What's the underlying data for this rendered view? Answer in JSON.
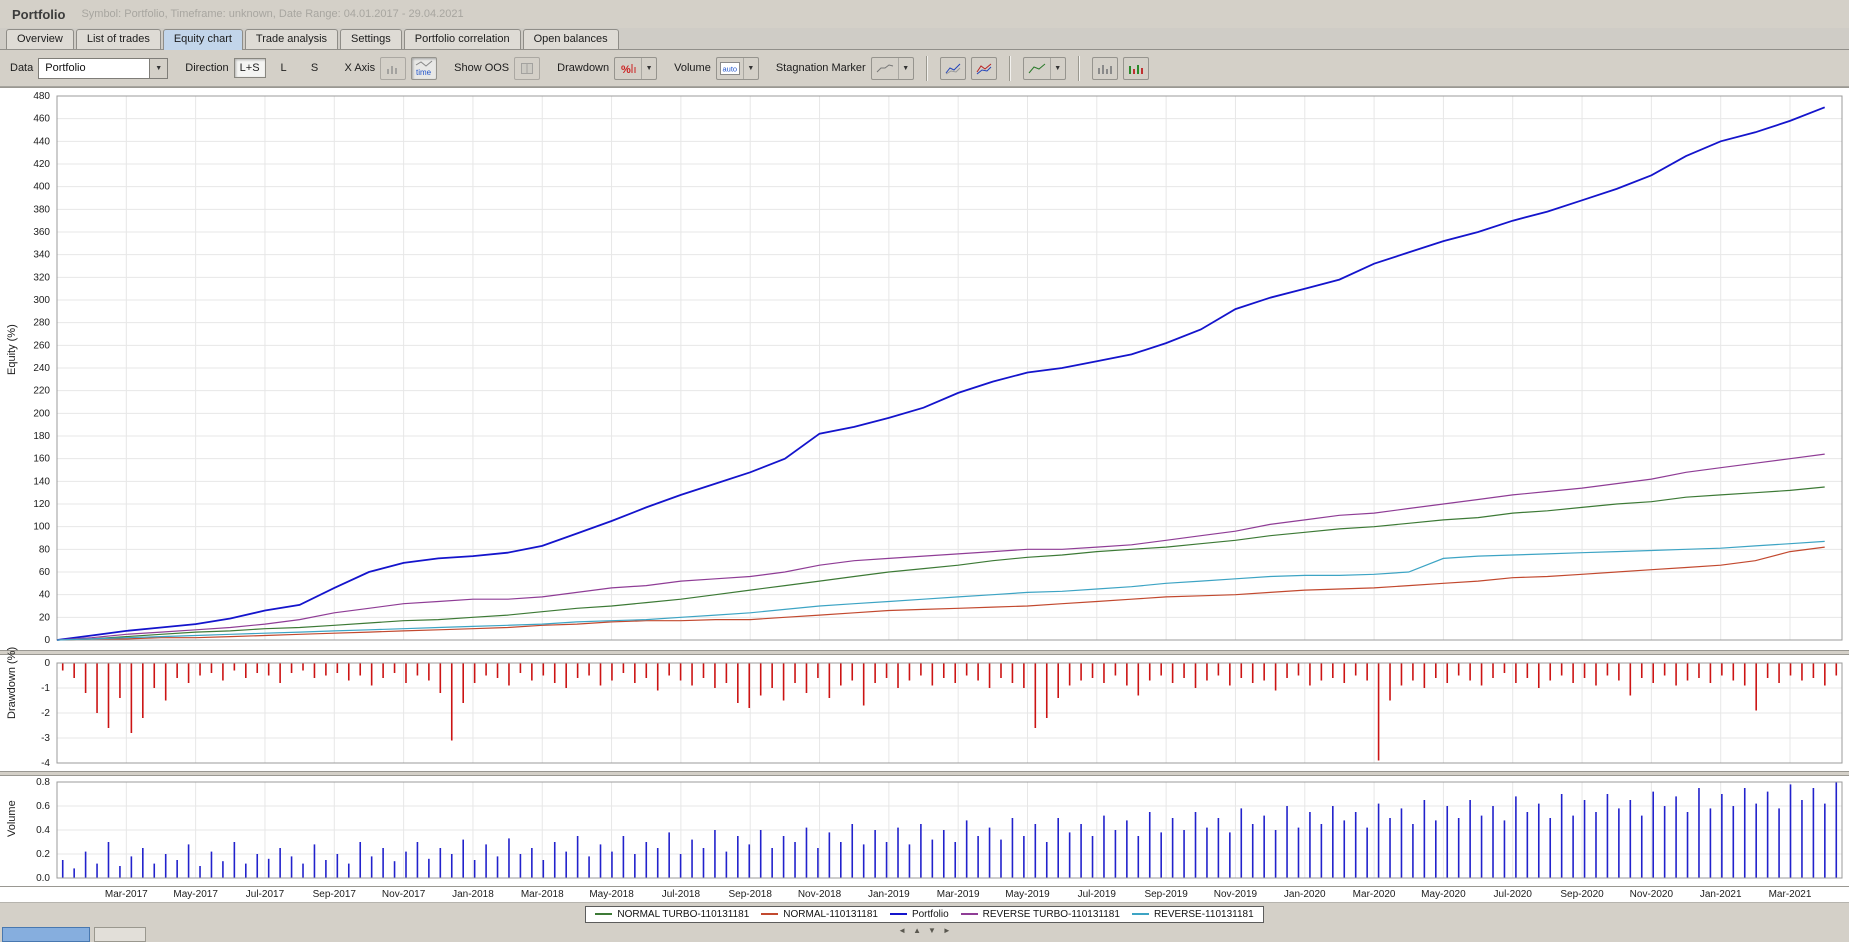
{
  "window": {
    "title": "Portfolio",
    "subtitle": "Symbol: Portfolio, Timeframe: unknown, Date Range: 04.01.2017 - 29.04.2021"
  },
  "tabs": [
    {
      "label": "Overview",
      "active": false
    },
    {
      "label": "List of trades",
      "active": false
    },
    {
      "label": "Equity chart",
      "active": true
    },
    {
      "label": "Trade analysis",
      "active": false
    },
    {
      "label": "Settings",
      "active": false
    },
    {
      "label": "Portfolio correlation",
      "active": false
    },
    {
      "label": "Open balances",
      "active": false
    }
  ],
  "toolbar": {
    "data_label": "Data",
    "data_value": "Portfolio",
    "direction_label": "Direction",
    "direction_options": [
      "L+S",
      "L",
      "S"
    ],
    "x_axis_label": "X Axis",
    "time_button_label": "time",
    "show_oos_label": "Show OOS",
    "drawdown_label": "Drawdown",
    "drawdown_icon_glyph": "%",
    "volume_label": "Volume",
    "volume_mode": "auto",
    "stagnation_label": "Stagnation Marker"
  },
  "chart_data": [
    {
      "type": "line",
      "ylabel": "Equity (%)",
      "ylim": [
        0,
        480
      ],
      "ytick_step": 20,
      "x_unit": "month",
      "x_start_label": "Jan-2017",
      "n_points": 52,
      "x_tick_months": [
        2,
        4,
        6,
        8,
        10,
        12,
        14,
        16,
        18,
        20,
        22,
        24,
        26,
        28,
        30,
        32,
        34,
        36,
        38,
        40,
        42,
        44,
        46,
        48,
        50
      ],
      "x_tick_labels": [
        "Mar-2017",
        "May-2017",
        "Jul-2017",
        "Sep-2017",
        "Nov-2017",
        "Jan-2018",
        "Mar-2018",
        "May-2018",
        "Jul-2018",
        "Sep-2018",
        "Nov-2018",
        "Jan-2019",
        "Mar-2019",
        "May-2019",
        "Jul-2019",
        "Sep-2019",
        "Nov-2019",
        "Jan-2020",
        "Mar-2020",
        "May-2020",
        "Jul-2020",
        "Sep-2020",
        "Nov-2020",
        "Jan-2021",
        "Mar-2021"
      ],
      "series": [
        {
          "name": "NORMAL TURBO-110131181",
          "color": "#3d7a36",
          "values": [
            0,
            1,
            3,
            5,
            7,
            8,
            10,
            11,
            13,
            15,
            17,
            18,
            20,
            22,
            25,
            28,
            30,
            33,
            36,
            40,
            44,
            48,
            52,
            56,
            60,
            63,
            66,
            70,
            73,
            75,
            78,
            80,
            82,
            85,
            88,
            92,
            95,
            98,
            100,
            103,
            106,
            108,
            112,
            114,
            117,
            120,
            122,
            126,
            128,
            130,
            132,
            135
          ]
        },
        {
          "name": "NORMAL-110131181",
          "color": "#c2492f",
          "values": [
            0,
            1,
            1,
            2,
            2,
            3,
            4,
            5,
            6,
            7,
            8,
            9,
            10,
            11,
            13,
            14,
            16,
            17,
            17,
            18,
            18,
            20,
            22,
            24,
            26,
            27,
            28,
            29,
            30,
            32,
            34,
            36,
            38,
            39,
            40,
            42,
            44,
            45,
            46,
            48,
            50,
            52,
            55,
            56,
            58,
            60,
            62,
            64,
            66,
            70,
            78,
            82
          ]
        },
        {
          "name": "Portfolio",
          "color": "#1414cc",
          "values": [
            0,
            4,
            8,
            11,
            14,
            19,
            26,
            31,
            46,
            60,
            68,
            72,
            74,
            77,
            83,
            94,
            105,
            117,
            128,
            138,
            148,
            160,
            182,
            188,
            196,
            205,
            218,
            228,
            236,
            240,
            246,
            252,
            262,
            274,
            292,
            302,
            310,
            318,
            332,
            342,
            352,
            360,
            370,
            378,
            388,
            398,
            410,
            427,
            440,
            448,
            458,
            470
          ]
        },
        {
          "name": "REVERSE TURBO-110131181",
          "color": "#8f3d96",
          "values": [
            0,
            2,
            5,
            7,
            9,
            11,
            14,
            18,
            24,
            28,
            32,
            34,
            36,
            36,
            38,
            42,
            46,
            48,
            52,
            54,
            56,
            60,
            66,
            70,
            72,
            74,
            76,
            78,
            80,
            80,
            82,
            84,
            88,
            92,
            96,
            102,
            106,
            110,
            112,
            116,
            120,
            124,
            128,
            131,
            134,
            138,
            142,
            148,
            152,
            156,
            160,
            164
          ]
        },
        {
          "name": "REVERSE-110131181",
          "color": "#3da4c4",
          "values": [
            0,
            1,
            2,
            3,
            4,
            5,
            6,
            7,
            8,
            9,
            10,
            11,
            12,
            13,
            14,
            16,
            17,
            18,
            20,
            22,
            24,
            27,
            30,
            32,
            34,
            36,
            38,
            40,
            42,
            43,
            45,
            47,
            50,
            52,
            54,
            56,
            57,
            57,
            58,
            60,
            72,
            74,
            75,
            76,
            77,
            78,
            79,
            80,
            81,
            83,
            85,
            87
          ]
        }
      ]
    },
    {
      "type": "bar",
      "ylabel": "Drawdown (%)",
      "ylim": [
        -4,
        0
      ],
      "yticks": [
        0,
        -1,
        -2,
        -3,
        -4
      ],
      "color": "#cc1414",
      "values": [
        -0.3,
        -0.6,
        -1.2,
        -2.0,
        -2.6,
        -1.4,
        -2.8,
        -2.2,
        -1.0,
        -1.5,
        -0.6,
        -0.8,
        -0.5,
        -0.4,
        -0.7,
        -0.3,
        -0.6,
        -0.4,
        -0.5,
        -0.8,
        -0.4,
        -0.3,
        -0.6,
        -0.5,
        -0.4,
        -0.7,
        -0.5,
        -0.9,
        -0.6,
        -0.4,
        -0.8,
        -0.5,
        -0.7,
        -1.2,
        -3.1,
        -1.6,
        -0.8,
        -0.5,
        -0.6,
        -0.9,
        -0.4,
        -0.7,
        -0.5,
        -0.8,
        -1.0,
        -0.6,
        -0.5,
        -0.9,
        -0.7,
        -0.4,
        -0.8,
        -0.6,
        -1.1,
        -0.5,
        -0.7,
        -0.9,
        -0.6,
        -1.0,
        -0.8,
        -1.6,
        -1.8,
        -1.3,
        -1.0,
        -1.5,
        -0.8,
        -1.2,
        -0.6,
        -1.4,
        -0.9,
        -0.7,
        -1.7,
        -0.8,
        -0.6,
        -1.0,
        -0.7,
        -0.5,
        -0.9,
        -0.6,
        -0.8,
        -0.5,
        -0.7,
        -1.0,
        -0.6,
        -0.8,
        -1.0,
        -2.6,
        -2.2,
        -1.4,
        -0.9,
        -0.7,
        -0.6,
        -0.8,
        -0.5,
        -0.9,
        -1.3,
        -0.7,
        -0.5,
        -0.8,
        -0.6,
        -1.0,
        -0.7,
        -0.5,
        -0.9,
        -0.6,
        -0.8,
        -0.7,
        -1.1,
        -0.6,
        -0.5,
        -0.9,
        -0.7,
        -0.6,
        -0.8,
        -0.5,
        -0.7,
        -3.9,
        -1.5,
        -0.9,
        -0.7,
        -1.0,
        -0.6,
        -0.8,
        -0.5,
        -0.7,
        -0.9,
        -0.6,
        -0.4,
        -0.8,
        -0.6,
        -1.0,
        -0.7,
        -0.5,
        -0.8,
        -0.6,
        -0.9,
        -0.5,
        -0.7,
        -1.3,
        -0.6,
        -0.8,
        -0.5,
        -0.9,
        -0.7,
        -0.6,
        -0.8,
        -0.5,
        -0.7,
        -0.9,
        -1.9,
        -0.6,
        -0.8,
        -0.5,
        -0.7,
        -0.6,
        -0.9,
        -0.5
      ]
    },
    {
      "type": "bar",
      "ylabel": "Volume",
      "ylim": [
        0,
        0.8
      ],
      "yticks": [
        0,
        0.2,
        0.4,
        0.6,
        0.8
      ],
      "color": "#2222cc",
      "values": [
        0.15,
        0.08,
        0.22,
        0.12,
        0.3,
        0.1,
        0.18,
        0.25,
        0.12,
        0.2,
        0.15,
        0.28,
        0.1,
        0.22,
        0.14,
        0.3,
        0.12,
        0.2,
        0.16,
        0.25,
        0.18,
        0.12,
        0.28,
        0.15,
        0.2,
        0.12,
        0.3,
        0.18,
        0.25,
        0.14,
        0.22,
        0.3,
        0.16,
        0.25,
        0.2,
        0.32,
        0.15,
        0.28,
        0.18,
        0.33,
        0.2,
        0.25,
        0.15,
        0.3,
        0.22,
        0.35,
        0.18,
        0.28,
        0.22,
        0.35,
        0.2,
        0.3,
        0.25,
        0.38,
        0.2,
        0.32,
        0.25,
        0.4,
        0.22,
        0.35,
        0.28,
        0.4,
        0.25,
        0.35,
        0.3,
        0.42,
        0.25,
        0.38,
        0.3,
        0.45,
        0.28,
        0.4,
        0.3,
        0.42,
        0.28,
        0.45,
        0.32,
        0.4,
        0.3,
        0.48,
        0.35,
        0.42,
        0.32,
        0.5,
        0.35,
        0.45,
        0.3,
        0.5,
        0.38,
        0.45,
        0.35,
        0.52,
        0.4,
        0.48,
        0.35,
        0.55,
        0.38,
        0.5,
        0.4,
        0.55,
        0.42,
        0.5,
        0.38,
        0.58,
        0.45,
        0.52,
        0.4,
        0.6,
        0.42,
        0.55,
        0.45,
        0.6,
        0.48,
        0.55,
        0.42,
        0.62,
        0.5,
        0.58,
        0.45,
        0.65,
        0.48,
        0.6,
        0.5,
        0.65,
        0.52,
        0.6,
        0.48,
        0.68,
        0.55,
        0.62,
        0.5,
        0.7,
        0.52,
        0.65,
        0.55,
        0.7,
        0.58,
        0.65,
        0.52,
        0.72,
        0.6,
        0.68,
        0.55,
        0.75,
        0.58,
        0.7,
        0.6,
        0.75,
        0.62,
        0.72,
        0.58,
        0.78,
        0.65,
        0.75,
        0.62,
        0.8
      ]
    }
  ],
  "bottom": {
    "scroll_arrows": [
      "◄",
      "▲",
      "▼",
      "►"
    ]
  }
}
